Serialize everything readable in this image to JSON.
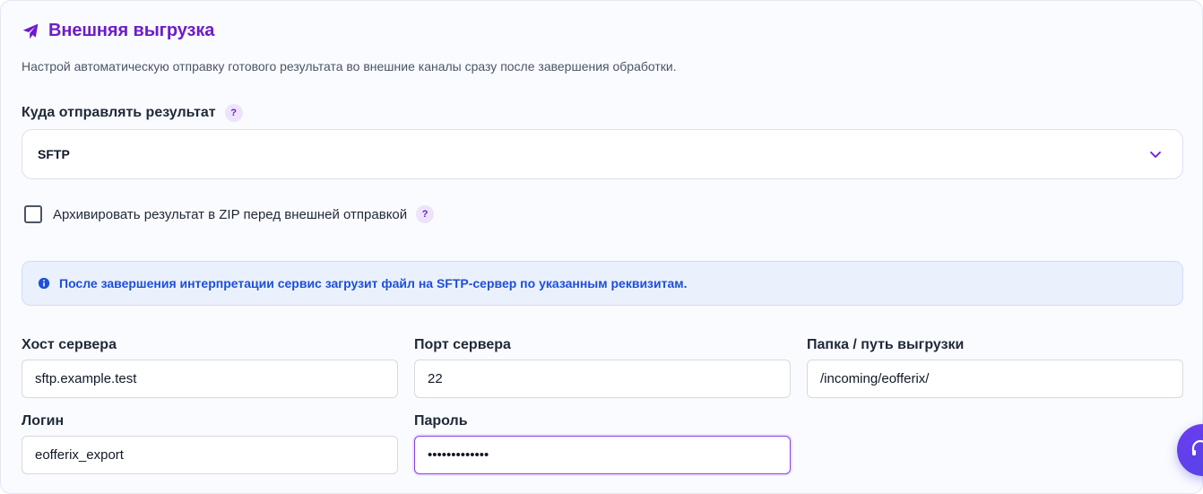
{
  "section": {
    "title": "Внешняя выгрузка",
    "description": "Настрой автоматическую отправку готового результата во внешние каналы сразу после завершения обработки."
  },
  "destination": {
    "label": "Куда отправлять результат",
    "help": "?",
    "selected": "SFTP"
  },
  "zip_option": {
    "label": "Архивировать результат в ZIP перед внешней отправкой",
    "help": "?",
    "checked": false
  },
  "info": {
    "text": "После завершения интерпретации сервис загрузит файл на SFTP-сервер по указанным реквизитам."
  },
  "fields": {
    "host": {
      "label": "Хост сервера",
      "value": "sftp.example.test"
    },
    "port": {
      "label": "Порт сервера",
      "value": "22"
    },
    "path": {
      "label": "Папка / путь выгрузки",
      "value": "/incoming/eofferix/"
    },
    "login": {
      "label": "Логин",
      "value": "eofferix_export"
    },
    "password": {
      "label": "Пароль",
      "value": "•••••••••••••"
    }
  },
  "icons": {
    "title": "paper-plane-icon",
    "select": "chevron-down-icon",
    "info": "info-circle-icon",
    "fab": "headset-icon"
  },
  "colors": {
    "accent": "#6d1cc9",
    "info_text": "#1e4fd6",
    "info_bg": "#eaf1fd"
  }
}
